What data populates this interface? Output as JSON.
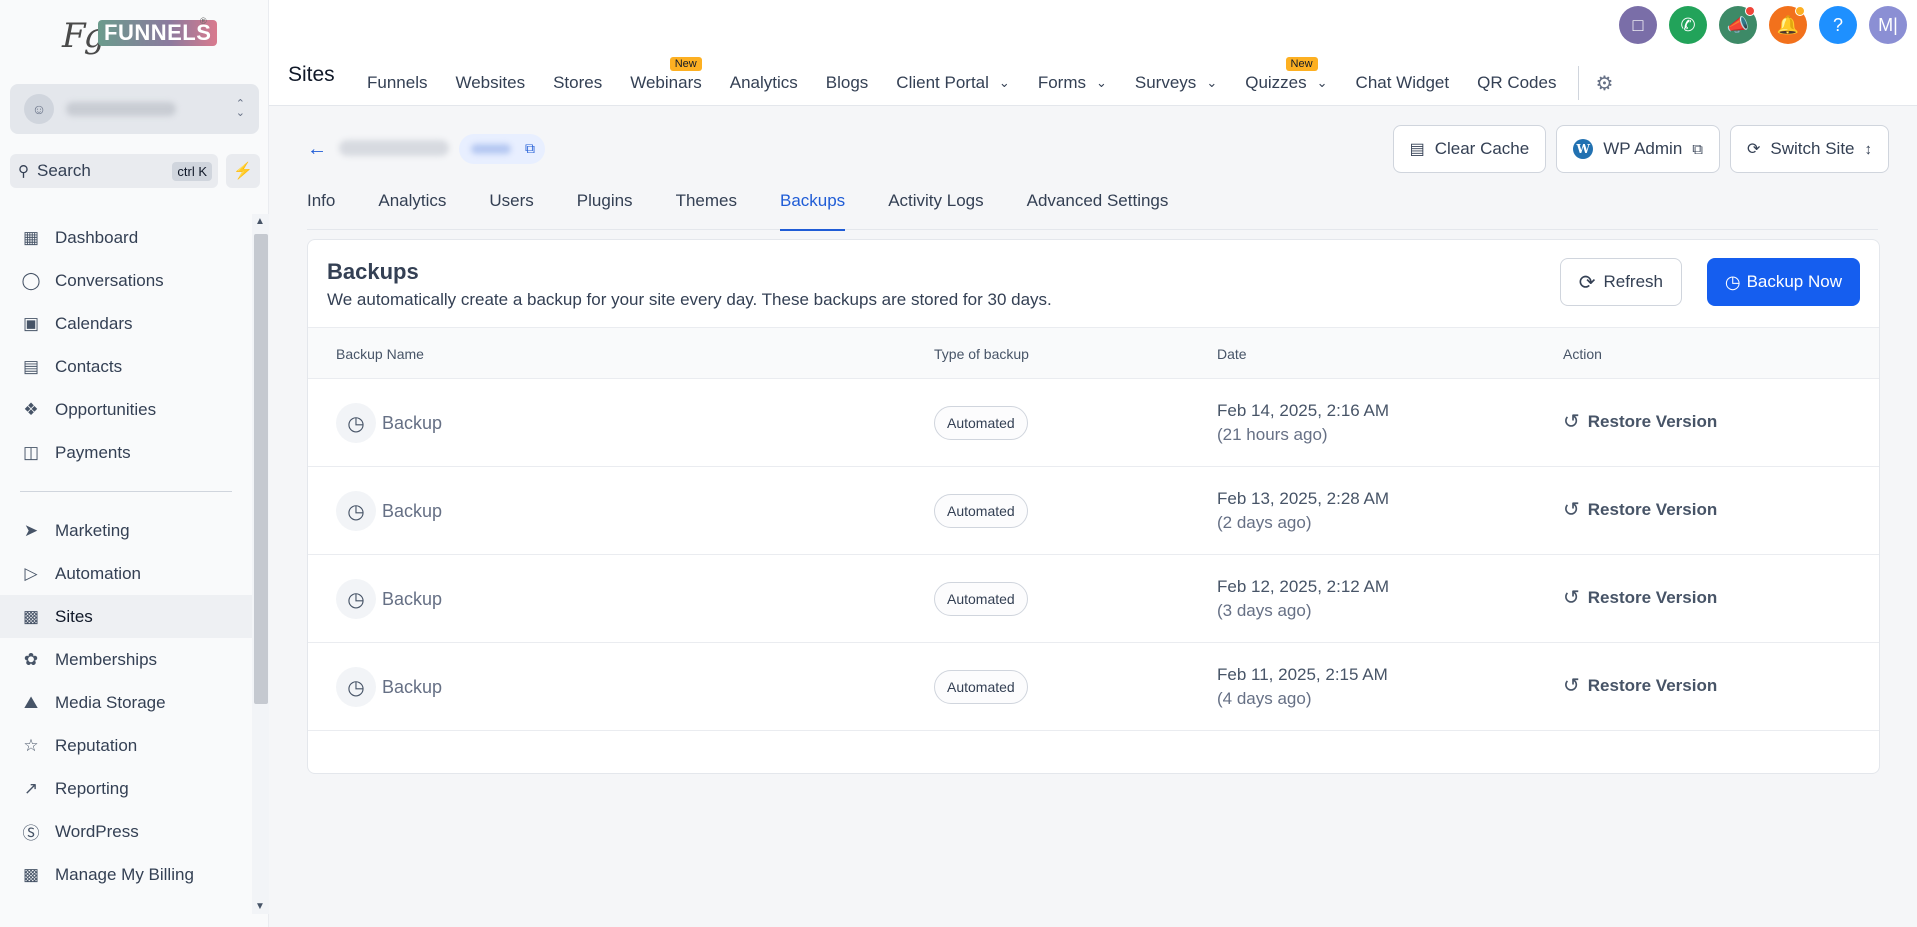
{
  "brand": {
    "logo_prefix": "Fg",
    "logo_word": "FUNNELS",
    "logo_mark": "®"
  },
  "sidebar": {
    "search_label": "Search",
    "search_shortcut": "ctrl K",
    "items": [
      {
        "label": "Dashboard",
        "icon": "dashboard-icon"
      },
      {
        "label": "Conversations",
        "icon": "chat-icon"
      },
      {
        "label": "Calendars",
        "icon": "calendar-icon"
      },
      {
        "label": "Contacts",
        "icon": "contacts-icon"
      },
      {
        "label": "Opportunities",
        "icon": "opportunities-icon"
      },
      {
        "label": "Payments",
        "icon": "payments-icon"
      }
    ],
    "items2": [
      {
        "label": "Marketing",
        "icon": "send-icon"
      },
      {
        "label": "Automation",
        "icon": "automation-icon"
      },
      {
        "label": "Sites",
        "icon": "sites-icon",
        "active": true
      },
      {
        "label": "Memberships",
        "icon": "award-icon"
      },
      {
        "label": "Media Storage",
        "icon": "image-icon"
      },
      {
        "label": "Reputation",
        "icon": "star-icon"
      },
      {
        "label": "Reporting",
        "icon": "trend-icon"
      },
      {
        "label": "WordPress",
        "icon": "wordpress-icon"
      },
      {
        "label": "Manage My Billing",
        "icon": "billing-icon"
      }
    ]
  },
  "topbar": {
    "title": "Sites",
    "nav": [
      {
        "label": "Funnels"
      },
      {
        "label": "Websites"
      },
      {
        "label": "Stores"
      },
      {
        "label": "Webinars",
        "badge": "New"
      },
      {
        "label": "Analytics"
      },
      {
        "label": "Blogs"
      },
      {
        "label": "Client Portal",
        "dropdown": true
      },
      {
        "label": "Forms",
        "dropdown": true
      },
      {
        "label": "Surveys",
        "dropdown": true
      },
      {
        "label": "Quizzes",
        "dropdown": true,
        "badge": "New"
      },
      {
        "label": "Chat Widget"
      },
      {
        "label": "QR Codes"
      }
    ],
    "avatar_initials": "M|",
    "icon_colors": {
      "chat": "#7a6ea8",
      "phone": "#22a35a",
      "megaphone": "#3d8a67",
      "bell": "#f2711c",
      "help": "#1e90ff",
      "avatar": "#8b8fd4"
    },
    "help_glyph": "?"
  },
  "site_header": {
    "buttons": {
      "clear_cache": "Clear Cache",
      "wp_admin": "WP Admin",
      "switch_site": "Switch Site"
    },
    "tabs": [
      "Info",
      "Analytics",
      "Users",
      "Plugins",
      "Themes",
      "Backups",
      "Activity Logs",
      "Advanced Settings"
    ],
    "active_tab": "Backups"
  },
  "backups": {
    "title": "Backups",
    "subtitle": "We automatically create a backup for your site every day. These backups are stored for 30 days.",
    "refresh_label": "Refresh",
    "backup_now_label": "Backup Now",
    "columns": [
      "Backup Name",
      "Type of backup",
      "Date",
      "Action"
    ],
    "rows": [
      {
        "name": "Backup",
        "type": "Automated",
        "date": "Feb 14, 2025, 2:16 AM",
        "ago": "(21 hours ago)",
        "action": "Restore Version"
      },
      {
        "name": "Backup",
        "type": "Automated",
        "date": "Feb 13, 2025, 2:28 AM",
        "ago": "(2 days ago)",
        "action": "Restore Version"
      },
      {
        "name": "Backup",
        "type": "Automated",
        "date": "Feb 12, 2025, 2:12 AM",
        "ago": "(3 days ago)",
        "action": "Restore Version"
      },
      {
        "name": "Backup",
        "type": "Automated",
        "date": "Feb 11, 2025, 2:15 AM",
        "ago": "(4 days ago)",
        "action": "Restore Version"
      }
    ]
  },
  "colors": {
    "primary": "#155eef",
    "accent_link": "#1f5cd6",
    "badge_new": "#fdb022"
  }
}
